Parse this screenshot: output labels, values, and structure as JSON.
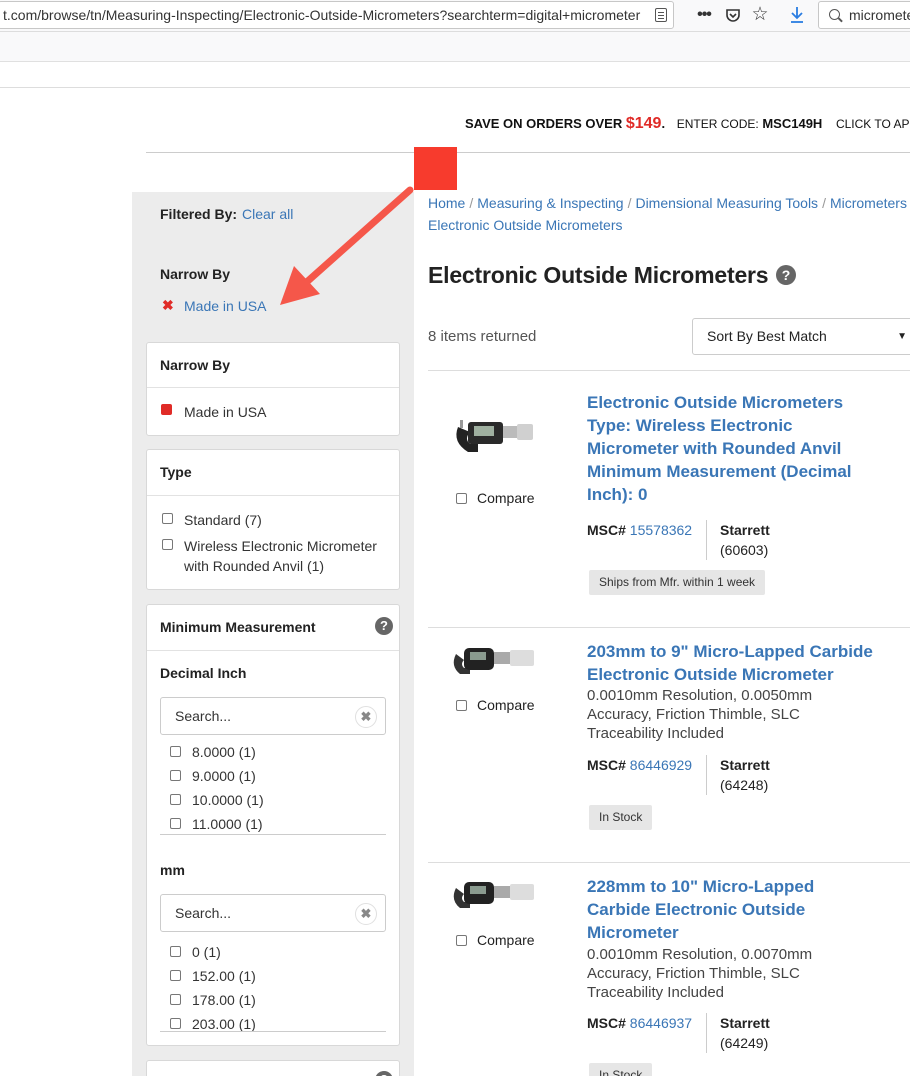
{
  "browser": {
    "url": "t.com/browse/tn/Measuring-Inspecting/Electronic-Outside-Micrometers?searchterm=digital+micrometer",
    "search_text": "micrometer",
    "icons": [
      "reader-view-icon",
      "more-icon",
      "pocket-icon",
      "bookmark-star-icon",
      "download-icon",
      "search-icon"
    ]
  },
  "promo": {
    "save_text": "SAVE ON ORDERS OVER",
    "amount": "$149",
    "period": ".",
    "enter_code": "ENTER CODE:",
    "code": "MSC149H",
    "click": "CLICK TO APPLY"
  },
  "sidebar": {
    "filtered_by": "Filtered By:",
    "clear_all": "Clear all",
    "narrow_by": "Narrow By",
    "active_filter": "Made in USA",
    "narrow_panel": {
      "title": "Narrow By",
      "item": "Made in USA"
    },
    "type_panel": {
      "title": "Type",
      "options": [
        {
          "label": "Standard (7)"
        },
        {
          "label": "Wireless Electronic Micrometer with Rounded Anvil (1)"
        }
      ]
    },
    "min_measurement_panel": {
      "title": "Minimum Measurement",
      "decimal_inch": {
        "label": "Decimal Inch",
        "search_placeholder": "Search...",
        "options": [
          "8.0000 (1)",
          "9.0000 (1)",
          "10.0000 (1)",
          "11.0000 (1)"
        ]
      },
      "mm": {
        "label": "mm",
        "search_placeholder": "Search...",
        "options": [
          "0 (1)",
          "152.00 (1)",
          "178.00 (1)",
          "203.00 (1)"
        ]
      }
    }
  },
  "breadcrumb": {
    "items": [
      "Home",
      "Measuring & Inspecting",
      "Dimensional Measuring Tools",
      "Micrometers"
    ],
    "current": "Electronic Outside Micrometers"
  },
  "main": {
    "title": "Electronic Outside Micrometers",
    "items_count": "8 items returned",
    "sort_label": "Sort By Best Match",
    "compare_label": "Compare",
    "msc_label": "MSC#",
    "products": [
      {
        "title": "Electronic Outside Micrometers Type: Wireless Electronic Micrometer with Rounded Anvil Minimum Measurement (Decimal Inch): 0",
        "desc": "",
        "msc": "15578362",
        "brand": "Starrett",
        "model": "(60603)",
        "badge": "Ships from Mfr. within 1 week"
      },
      {
        "title": "203mm to 9\" Micro-Lapped Carbide Electronic Outside Micrometer",
        "desc": "0.0010mm Resolution, 0.0050mm Accuracy, Friction Thimble, SLC Traceability Included",
        "msc": "86446929",
        "brand": "Starrett",
        "model": "(64248)",
        "badge": "In Stock"
      },
      {
        "title": "228mm to 10\" Micro-Lapped Carbide Electronic Outside Micrometer",
        "desc": "0.0010mm Resolution, 0.0070mm Accuracy, Friction Thimble, SLC Traceability Included",
        "msc": "86446937",
        "brand": "Starrett",
        "model": "(64249)",
        "badge": "In Stock"
      }
    ]
  },
  "colors": {
    "link": "#3a76b6",
    "accent_red": "#e02b27",
    "annotation": "#f73b2d"
  }
}
